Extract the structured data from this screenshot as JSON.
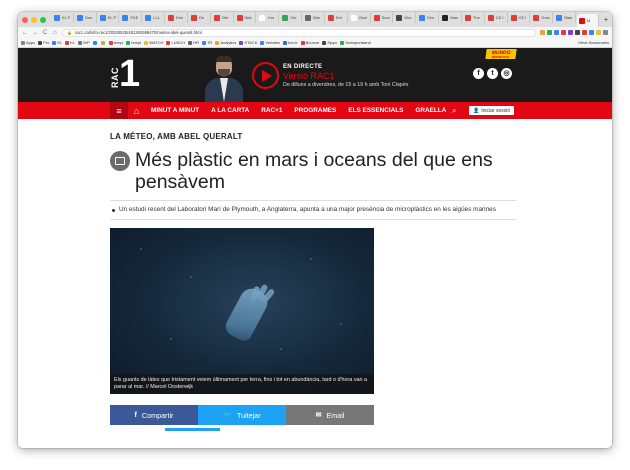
{
  "browser": {
    "tabs": [
      {
        "title": "KL F",
        "color": "#3b82f6"
      },
      {
        "title": "Goo",
        "color": "#3b82f6"
      },
      {
        "title": "KL P",
        "color": "#3b82f6"
      },
      {
        "title": "FKE",
        "color": "#3b82f6"
      },
      {
        "title": "LLL",
        "color": "#3b82f6"
      },
      {
        "title": "Een",
        "color": "#e23b3b"
      },
      {
        "title": "De",
        "color": "#e23b3b"
      },
      {
        "title": "Obr",
        "color": "#e23b3b"
      },
      {
        "title": "Wat",
        "color": "#e23b3b"
      },
      {
        "title": "Yoo",
        "color": "#ffffff"
      },
      {
        "title": "Chr",
        "color": "#34a853"
      },
      {
        "title": "Mar",
        "color": "#666666"
      },
      {
        "title": "Eer",
        "color": "#e23b3b"
      },
      {
        "title": "Gezi",
        "color": "#ffffff"
      },
      {
        "title": "Som",
        "color": "#e23b3b"
      },
      {
        "title": "Wor",
        "color": "#444444"
      },
      {
        "title": "Dric",
        "color": "#3b82f6"
      },
      {
        "title": "Was",
        "color": "#222222"
      },
      {
        "title": "The",
        "color": "#e23b3b"
      },
      {
        "title": "CE I",
        "color": "#e23b3b"
      },
      {
        "title": "CE I",
        "color": "#e23b3b"
      },
      {
        "title": "Grec",
        "color": "#e23b3b"
      },
      {
        "title": "Blan",
        "color": "#3b82f6"
      },
      {
        "title": "M",
        "color": "#e30613",
        "active": true
      }
    ],
    "new_tab": "+",
    "url": "rac1.cat/info-rac1/20200525/481392989470/meteo-abel-queralt.html",
    "nav": {
      "back": "←",
      "forward": "→",
      "reload": "C",
      "home": "⌂"
    },
    "bookmarks": [
      {
        "label": "Apps",
        "color": "#888888"
      },
      {
        "label": "Pro",
        "color": "#444444"
      },
      {
        "label": "KL",
        "color": "#3b82f6"
      },
      {
        "label": "KL",
        "color": "#e23b3b"
      },
      {
        "label": "WP",
        "color": "#777777"
      },
      {
        "label": "",
        "color": "#3b82f6"
      },
      {
        "label": "",
        "color": "#e2a53b"
      },
      {
        "label": "tempi",
        "color": "#e23b3b"
      },
      {
        "label": "tempi",
        "color": "#34a853"
      },
      {
        "label": "WATCH",
        "color": "#e2c23b"
      },
      {
        "label": "LUNCH",
        "color": "#e23b3b"
      },
      {
        "label": "HR",
        "color": "#666666"
      },
      {
        "label": "TR",
        "color": "#3b82f6"
      },
      {
        "label": "Analytics",
        "color": "#e2a53b"
      },
      {
        "label": "STACK",
        "color": "#7a3be2"
      },
      {
        "label": "Vertalen",
        "color": "#3b82f6"
      },
      {
        "label": "bol.ie",
        "color": "#1a73e8"
      },
      {
        "label": "Bounce",
        "color": "#e23b3b"
      },
      {
        "label": "Zippo",
        "color": "#444444"
      },
      {
        "label": "Swimportaand",
        "color": "#34a853"
      }
    ],
    "other_bookmarks": "Other Bookmarks"
  },
  "site": {
    "logo_rac": "RAC",
    "logo_one": "1",
    "live": {
      "label": "EN DIRECTE",
      "show": "Versió RAC1",
      "schedule": "De dilluns a divendres, de 15 a 19 h amb Toni Clapés"
    },
    "social": {
      "facebook": "f",
      "twitter": "t",
      "instagram": "◎"
    },
    "mundo": {
      "title": "MUNDO",
      "subtitle": "DEPORTIVO"
    },
    "nav": {
      "menu_icon": "≡",
      "home_icon": "⌂",
      "items": [
        "MINUT A MINUT",
        "A LA CARTA",
        "RAC+1",
        "PROGRAMES",
        "ELS ESSENCIALS",
        "GRAELLA"
      ],
      "search_icon": "⌕",
      "login": "Iniciar sessió",
      "login_icon": "👤"
    }
  },
  "article": {
    "kicker": "LA MÉTEO, AMB ABEL QUERALT",
    "headline": "Més plàstic en mars i oceans del que ens pensàvem",
    "summary": "Un estudi recent del Laboratori Marí de Plymouth, a Anglaterra, apunta a una major presència de microplàstics en les aigües marines",
    "caption": "Els guants de làtex que tristament veiem últimament per terra, fins i tot en abundància, tard o d'hora van a parar al mar. // Marcel Oosterwijk",
    "share": {
      "facebook": "Compartir",
      "twitter": "Tuitejar",
      "email": "Email"
    },
    "colors": {
      "accent": "#e30613",
      "facebook": "#3b5998",
      "twitter": "#1da1f2",
      "email": "#777777"
    }
  }
}
